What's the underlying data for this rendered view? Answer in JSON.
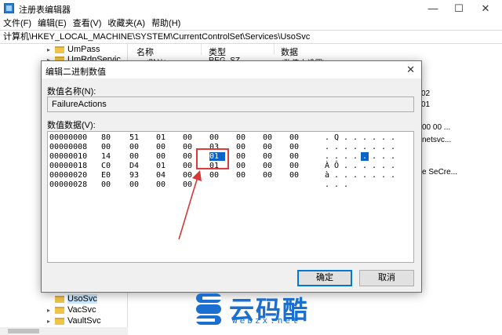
{
  "window": {
    "title": "注册表编辑器"
  },
  "menu": [
    "文件(F)",
    "编辑(E)",
    "查看(V)",
    "收藏夹(A)",
    "帮助(H)"
  ],
  "address": "计算机\\HKEY_LOCAL_MACHINE\\SYSTEM\\CurrentControlSet\\Services\\UsoSvc",
  "tree": {
    "items_top": [
      "UmPass",
      "UmRdpServic"
    ],
    "items_bottom": [
      "UsoSvc",
      "VacSvc",
      "VaultSvc"
    ]
  },
  "list": {
    "columns": [
      "名称",
      "类型",
      "数据"
    ],
    "fragments": [
      "(默认)",
      "REG_SZ",
      "(数值未设置)",
      "02",
      "01",
      "00 00 ...",
      "netsvc...",
      "e SeCre..."
    ]
  },
  "dialog": {
    "title": "编辑二进制数值",
    "name_label": "数值名称(N):",
    "name_value": "FailureActions",
    "data_label": "数值数据(V):",
    "rows": [
      {
        "addr": "00000000",
        "bytes": [
          "80",
          "51",
          "01",
          "00",
          "00",
          "00",
          "00",
          "00"
        ],
        "ascii": [
          ".",
          "Q",
          ".",
          ".",
          ".",
          ".",
          ".",
          "."
        ]
      },
      {
        "addr": "00000008",
        "bytes": [
          "00",
          "00",
          "00",
          "00",
          "03",
          "00",
          "00",
          "00"
        ],
        "ascii": [
          ".",
          ".",
          ".",
          ".",
          ".",
          ".",
          ".",
          "."
        ]
      },
      {
        "addr": "00000010",
        "bytes": [
          "14",
          "00",
          "00",
          "00",
          "01",
          "00",
          "00",
          "00"
        ],
        "ascii": [
          ".",
          ".",
          ".",
          ".",
          ".",
          ".",
          ".",
          "."
        ]
      },
      {
        "addr": "00000018",
        "bytes": [
          "C0",
          "D4",
          "01",
          "00",
          "01",
          "00",
          "00",
          "00"
        ],
        "ascii": [
          "À",
          "Ô",
          ".",
          ".",
          ".",
          ".",
          ".",
          "."
        ]
      },
      {
        "addr": "00000020",
        "bytes": [
          "E0",
          "93",
          "04",
          "00",
          "00",
          "00",
          "00",
          "00"
        ],
        "ascii": [
          "à",
          ".",
          ".",
          ".",
          ".",
          ".",
          ".",
          "."
        ]
      },
      {
        "addr": "00000028",
        "bytes": [
          "00",
          "00",
          "00",
          "00",
          "",
          "",
          "",
          ""
        ],
        "ascii": [
          ".",
          ".",
          ".",
          "",
          "",
          "",
          "",
          ""
        ]
      }
    ],
    "ok": "确定",
    "cancel": "取消"
  },
  "watermark": {
    "brand": "云码酷",
    "url": "webzx.net"
  },
  "colors": {
    "selection": "#0a64c8",
    "highlight_box": "#e03a3a",
    "accent_button": "#0078d7",
    "brand": "#1a6fd0"
  }
}
